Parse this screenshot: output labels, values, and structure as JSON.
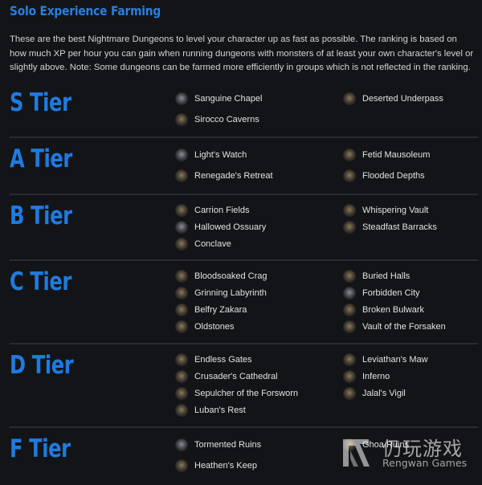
{
  "header": {
    "title": "Solo Experience Farming",
    "intro": "These are the best Nightmare Dungeons to level your character up as fast as possible. The ranking is based on how much XP per hour you can gain when running dungeons with monsters of at least your own character's level or slightly above. Note: Some dungeons can be farmed more efficiently in groups which is not reflected in the ranking."
  },
  "colors": {
    "background": "#131417",
    "accent": "#1f7be0",
    "divider": "#2a2b2f",
    "text": "#e2e2e2"
  },
  "tiers": [
    {
      "label": "S Tier",
      "left": [
        {
          "name": "Sanguine Chapel",
          "icon": "grey"
        },
        {
          "name": "Sirocco Caverns",
          "icon": "tan"
        }
      ],
      "right": [
        {
          "name": "Deserted Underpass",
          "icon": "tan"
        }
      ]
    },
    {
      "label": "A Tier",
      "left": [
        {
          "name": "Light's Watch",
          "icon": "grey"
        },
        {
          "name": "Renegade's Retreat",
          "icon": "tan"
        }
      ],
      "right": [
        {
          "name": "Fetid Mausoleum",
          "icon": "tan"
        },
        {
          "name": "Flooded Depths",
          "icon": "tan"
        }
      ]
    },
    {
      "label": "B Tier",
      "left": [
        {
          "name": "Carrion Fields",
          "icon": "tan"
        },
        {
          "name": "Hallowed Ossuary",
          "icon": "grey"
        },
        {
          "name": "Conclave",
          "icon": "tan"
        }
      ],
      "right": [
        {
          "name": "Whispering Vault",
          "icon": "tan"
        },
        {
          "name": "Steadfast Barracks",
          "icon": "tan"
        }
      ]
    },
    {
      "label": "C Tier",
      "left": [
        {
          "name": "Bloodsoaked Crag",
          "icon": "tan"
        },
        {
          "name": "Grinning Labyrinth",
          "icon": "tan"
        },
        {
          "name": "Belfry Zakara",
          "icon": "tan"
        },
        {
          "name": "Oldstones",
          "icon": "tan"
        }
      ],
      "right": [
        {
          "name": "Buried Halls",
          "icon": "tan"
        },
        {
          "name": "Forbidden City",
          "icon": "grey"
        },
        {
          "name": "Broken Bulwark",
          "icon": "tan"
        },
        {
          "name": "Vault of the Forsaken",
          "icon": "tan"
        }
      ]
    },
    {
      "label": "D Tier",
      "left": [
        {
          "name": "Endless Gates",
          "icon": "tan"
        },
        {
          "name": "Crusader's Cathedral",
          "icon": "tan"
        },
        {
          "name": "Sepulcher of the Forsworn",
          "icon": "tan"
        },
        {
          "name": "Luban's Rest",
          "icon": "tan"
        }
      ],
      "right": [
        {
          "name": "Leviathan's Maw",
          "icon": "tan"
        },
        {
          "name": "Inferno",
          "icon": "tan"
        },
        {
          "name": "Jalal's Vigil",
          "icon": "tan"
        }
      ]
    },
    {
      "label": "F Tier",
      "left": [
        {
          "name": "Tormented Ruins",
          "icon": "grey"
        },
        {
          "name": "Heathen's Keep",
          "icon": "tan"
        }
      ],
      "right": [
        {
          "name": "Ghoa Ruins",
          "icon": "tan"
        }
      ]
    }
  ],
  "watermark": {
    "chinese": "仍玩游戏",
    "english": "Rengwan Games"
  }
}
